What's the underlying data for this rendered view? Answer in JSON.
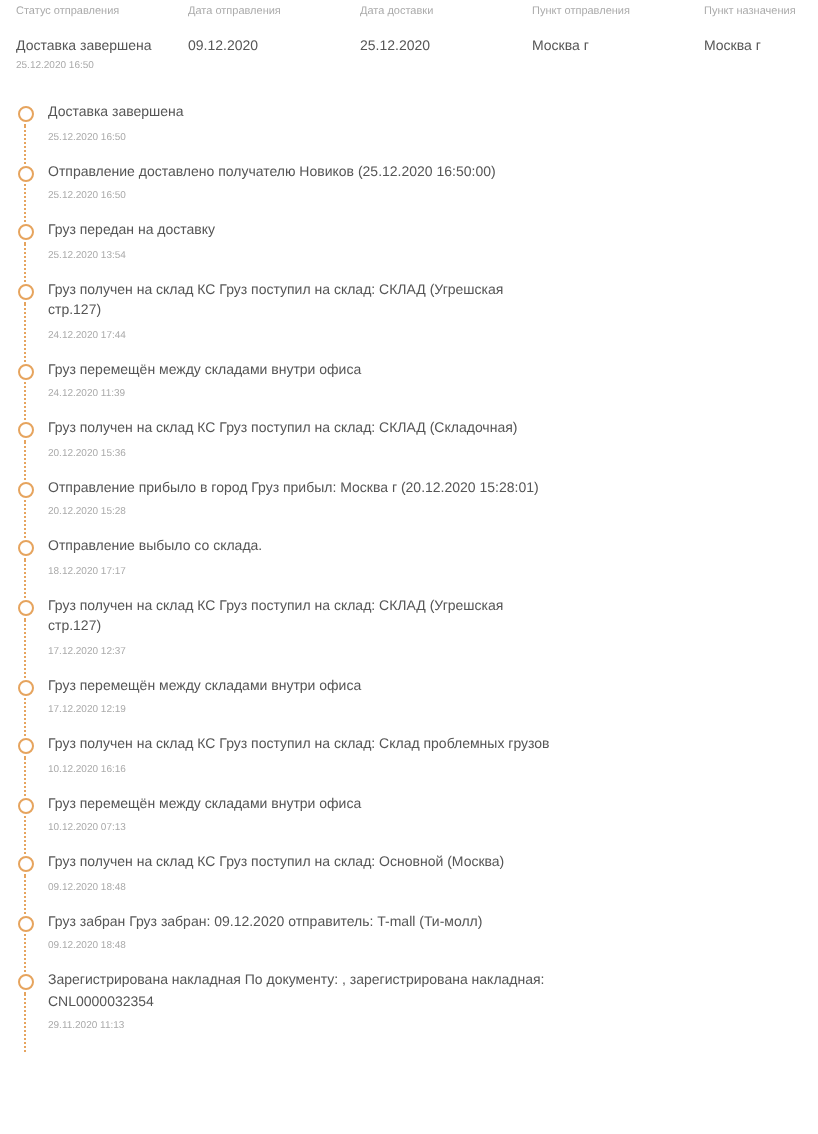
{
  "summary": {
    "columns": [
      {
        "label": "Статус отправления",
        "value": "Доставка завершена",
        "sub": "25.12.2020 16:50"
      },
      {
        "label": "Дата отправления",
        "value": "09.12.2020"
      },
      {
        "label": "Дата доставки",
        "value": "25.12.2020"
      },
      {
        "label": "Пункт отправления",
        "value": "Москва г"
      },
      {
        "label": "Пункт назначения",
        "value": "Москва г"
      }
    ]
  },
  "events": [
    {
      "text": "Доставка завершена",
      "date": "25.12.2020 16:50"
    },
    {
      "text": "Отправление доставлено получателю Новиков (25.12.2020 16:50:00)",
      "date": "25.12.2020 16:50"
    },
    {
      "text": "Груз передан на доставку",
      "date": "25.12.2020 13:54"
    },
    {
      "text": "Груз получен на склад КС Груз поступил на склад: СКЛАД (Угрешская стр.127)",
      "date": "24.12.2020 17:44"
    },
    {
      "text": "Груз перемещён между складами внутри офиса",
      "date": "24.12.2020 11:39"
    },
    {
      "text": "Груз получен на склад КС Груз поступил на склад: СКЛАД (Складочная)",
      "date": "20.12.2020 15:36"
    },
    {
      "text": "Отправление прибыло в город Груз прибыл: Москва г (20.12.2020 15:28:01)",
      "date": "20.12.2020 15:28"
    },
    {
      "text": "Отправление выбыло со склада.",
      "date": "18.12.2020 17:17"
    },
    {
      "text": "Груз получен на склад КС Груз поступил на склад: СКЛАД (Угрешская стр.127)",
      "date": "17.12.2020 12:37"
    },
    {
      "text": "Груз перемещён между складами внутри офиса",
      "date": "17.12.2020 12:19"
    },
    {
      "text": "Груз получен на склад КС Груз поступил на склад: Склад проблемных грузов",
      "date": "10.12.2020 16:16"
    },
    {
      "text": "Груз перемещён между складами внутри офиса",
      "date": "10.12.2020 07:13"
    },
    {
      "text": "Груз получен на склад КС Груз поступил на склад: Основной (Москва)",
      "date": "09.12.2020 18:48"
    },
    {
      "text": "Груз забран Груз забран: 09.12.2020 отправитель: T-mall (Ти-молл)",
      "date": "09.12.2020 18:48"
    },
    {
      "text": "Зарегистрирована накладная По документу: , зарегистрирована накладная: CNL0000032354",
      "date": "29.11.2020 11:13"
    }
  ]
}
